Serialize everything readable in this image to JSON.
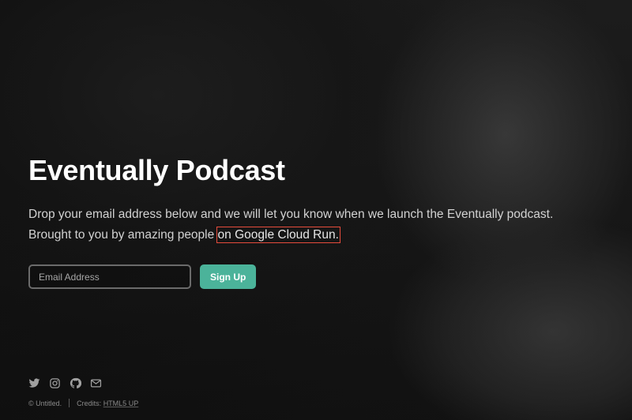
{
  "header": {
    "title": "Eventually Podcast",
    "description_line1": "Drop your email address below and we will let you know when we launch the Eventually podcast.",
    "description_line2_prefix": "Brought to you by amazing people ",
    "description_line2_highlight": "on Google Cloud Run."
  },
  "form": {
    "email_placeholder": "Email Address",
    "submit_label": "Sign Up"
  },
  "footer": {
    "icons": [
      "twitter-icon",
      "instagram-icon",
      "github-icon",
      "envelope-icon"
    ],
    "copyright": "© Untitled.",
    "credits_prefix": "Credits: ",
    "credits_link": "HTML5 UP"
  },
  "colors": {
    "accent": "#4bb39a",
    "highlight_border": "#e74c3c",
    "background": "#141414"
  }
}
